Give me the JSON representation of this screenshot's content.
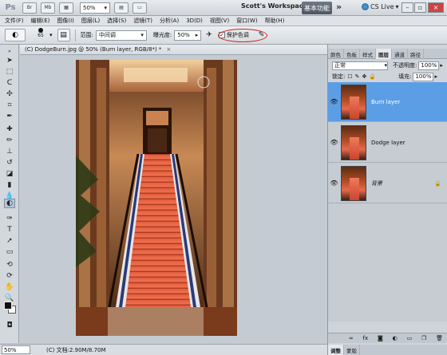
{
  "app": {
    "logo": "Ps",
    "zoom": "50%",
    "workspace_name": "Scott's Workspace",
    "workspace_button": "基本功能",
    "cs_live": "CS Live",
    "chevron": "»"
  },
  "menu": [
    "文件(F)",
    "编辑(E)",
    "图像(I)",
    "图层(L)",
    "选择(S)",
    "滤镜(T)",
    "分析(A)",
    "3D(D)",
    "视图(V)",
    "窗口(W)",
    "帮助(H)"
  ],
  "options": {
    "brush_size": "65",
    "range_label": "范围:",
    "range_value": "中间调",
    "exposure_label": "曝光度:",
    "exposure_value": "50%",
    "protect_tones_checked": "✓",
    "protect_tones_label": "保护色调"
  },
  "document": {
    "tab_title": "(C) DodgeBurn.jpg @ 50% (Burn layer, RGB/8*) *",
    "close": "×",
    "status_zoom": "50%",
    "status_info": "(C) 文档:2.90M/8.70M"
  },
  "panels": {
    "top_tabs": [
      "颜色",
      "色板",
      "样式",
      "图层",
      "通道",
      "路径"
    ],
    "active_tab": "图层",
    "blend_mode": "正常",
    "opacity_label": "不透明度:",
    "opacity_value": "100%",
    "lock_label": "锁定:",
    "fill_label": "填充:",
    "fill_value": "100%",
    "layers": [
      {
        "name": "Burn layer",
        "selected": true
      },
      {
        "name": "Dodge layer",
        "selected": false
      },
      {
        "name": "背景",
        "selected": false,
        "locked": true
      }
    ],
    "footer_icons": [
      "link-icon",
      "fx-icon",
      "mask-icon",
      "adjustment-icon",
      "group-icon",
      "new-layer-icon",
      "trash-icon"
    ],
    "footer_glyphs": [
      "∞",
      "fx",
      "◙",
      "◐",
      "▭",
      "❐",
      "🗑"
    ],
    "bottom_tabs": [
      "调整",
      "蒙版"
    ]
  },
  "colors": {
    "selection_blue": "#5c9ee6",
    "highlight_circle": "#d0281c"
  }
}
